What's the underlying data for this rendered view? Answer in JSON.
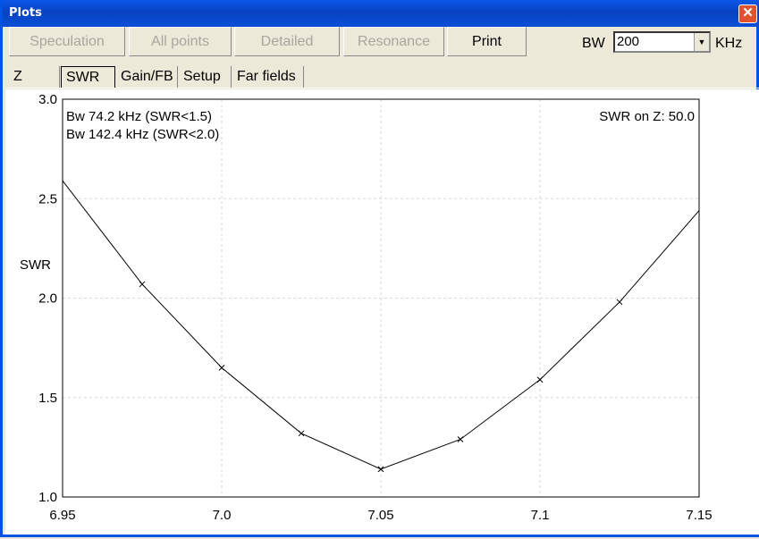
{
  "window": {
    "title": "Plots",
    "close_glyph": "✕"
  },
  "toolbar": {
    "buttons": [
      {
        "label": "Speculation",
        "enabled": false
      },
      {
        "label": "All points",
        "enabled": false
      },
      {
        "label": "Detailed",
        "enabled": false
      },
      {
        "label": "Resonance",
        "enabled": false
      },
      {
        "label": "Print",
        "enabled": true
      }
    ],
    "bw_label": "BW",
    "bw_value": "200",
    "bw_unit": "KHz"
  },
  "tabs": [
    {
      "label": "Z",
      "selected": false
    },
    {
      "label": "SWR",
      "selected": true
    },
    {
      "label": "Gain/FB",
      "selected": false
    },
    {
      "label": "Setup",
      "selected": false
    },
    {
      "label": "Far fields",
      "selected": false
    }
  ],
  "chart_data": {
    "type": "line",
    "ylabel": "SWR",
    "annotations": {
      "bw1": "Bw 74.2 kHz (SWR<1.5)",
      "bw2": "Bw 142.4 kHz (SWR<2.0)",
      "swr_on_z": "SWR on Z: 50.0"
    },
    "xlim": [
      6.95,
      7.15
    ],
    "ylim": [
      1.0,
      3.0
    ],
    "x_ticks": [
      "6.95",
      "7.0",
      "7.05",
      "7.1",
      "7.15"
    ],
    "y_ticks": [
      "1.0",
      "1.5",
      "2.0",
      "2.5",
      "3.0"
    ],
    "grid": true,
    "series": [
      {
        "x": [
          6.95,
          6.975,
          7.0,
          7.025,
          7.05,
          7.075,
          7.1,
          7.125,
          7.15
        ],
        "y": [
          2.59,
          2.07,
          1.65,
          1.32,
          1.14,
          1.29,
          1.59,
          1.98,
          2.44
        ]
      }
    ]
  }
}
